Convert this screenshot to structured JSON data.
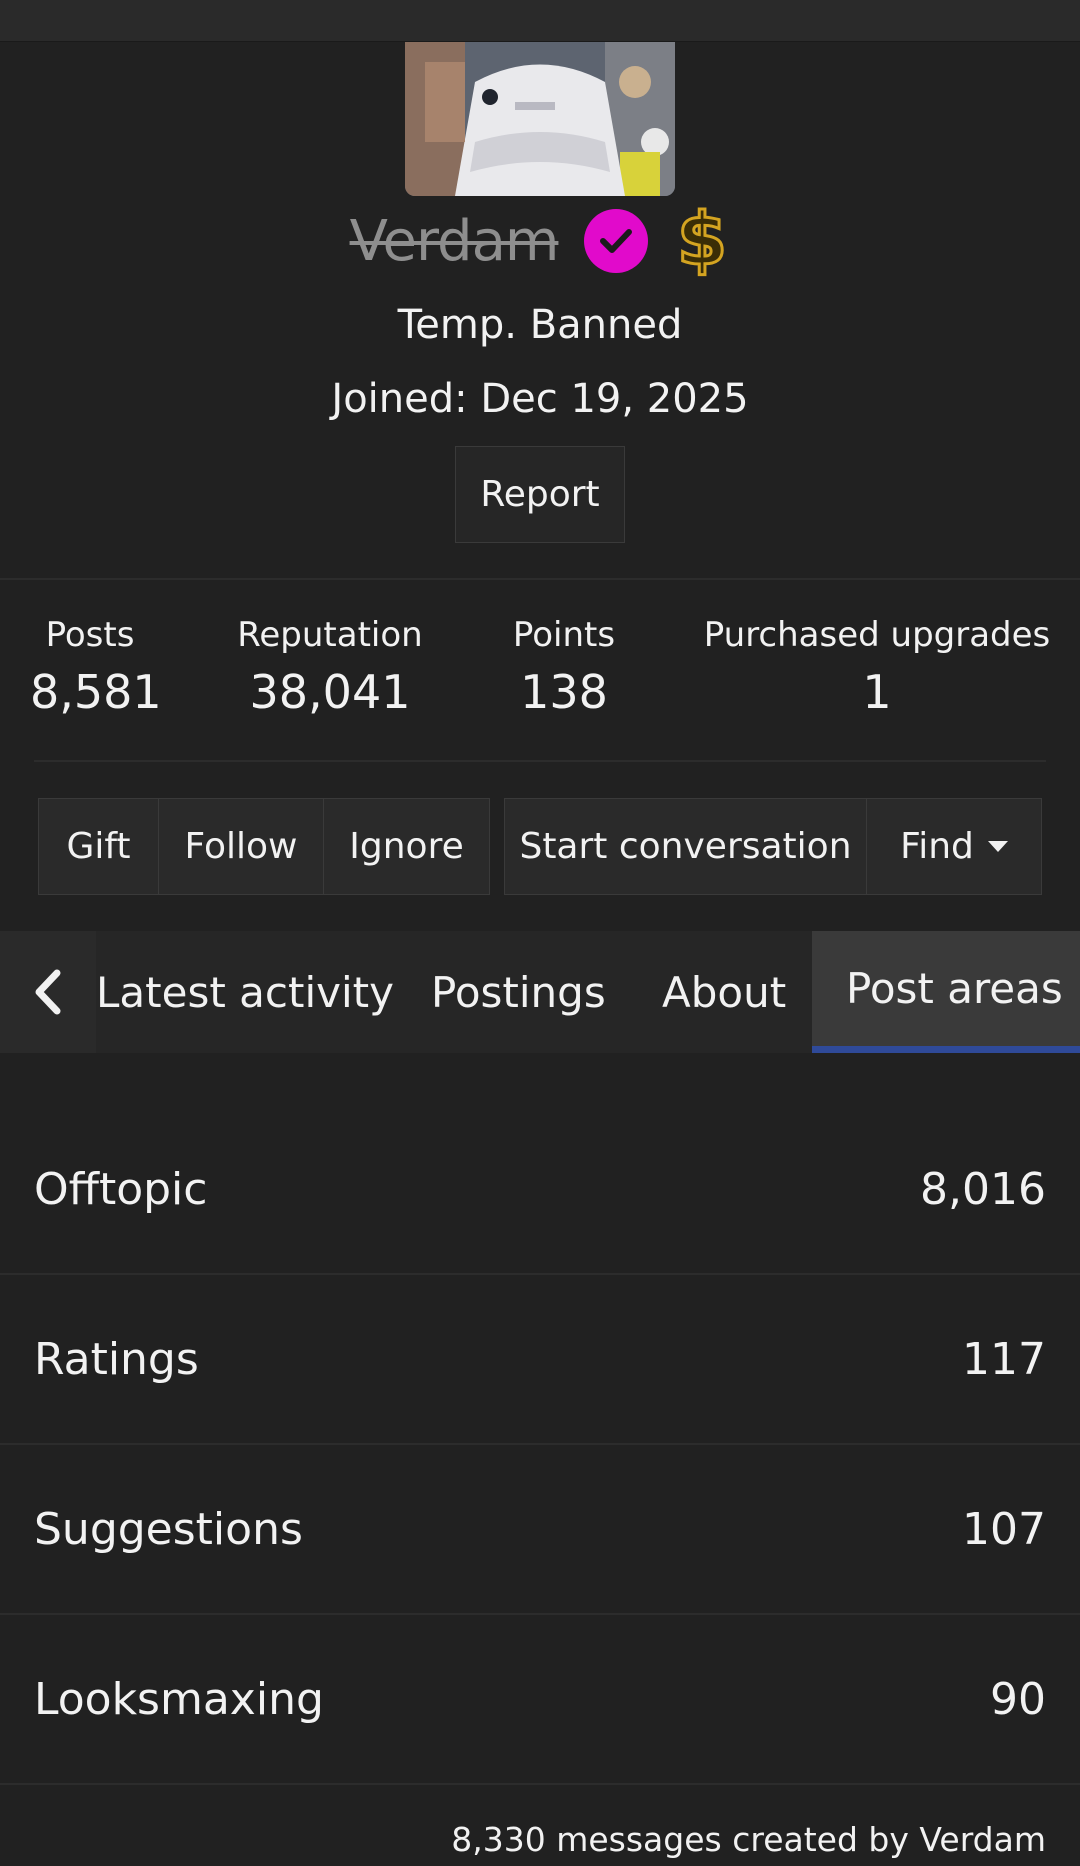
{
  "profile": {
    "username": "Verdam",
    "status": "Temp. Banned",
    "joined": "Joined: Dec 19, 2025",
    "report_label": "Report",
    "verified_badge_icon": "check-circle-icon",
    "upgrade_badge_icon": "dollar-icon",
    "verified_color": "#e10acb",
    "upgrade_color": "#d4a421"
  },
  "stats": [
    {
      "label": "Posts",
      "value": "8,581"
    },
    {
      "label": "Reputation",
      "value": "38,041"
    },
    {
      "label": "Points",
      "value": "138"
    },
    {
      "label": "Purchased upgrades",
      "value": "1"
    }
  ],
  "actions": {
    "gift": "Gift",
    "follow": "Follow",
    "ignore": "Ignore",
    "start_conversation": "Start conversation",
    "find": "Find"
  },
  "tabs": {
    "items": [
      "Latest activity",
      "Postings",
      "About",
      "Post areas"
    ],
    "active": "Post areas",
    "accent": "#2f4a99"
  },
  "post_areas": [
    {
      "name": "Offtopic",
      "count": "8,016"
    },
    {
      "name": "Ratings",
      "count": "117"
    },
    {
      "name": "Suggestions",
      "count": "107"
    },
    {
      "name": "Looksmaxing",
      "count": "90"
    }
  ],
  "summary": "8,330 messages created by Verdam"
}
